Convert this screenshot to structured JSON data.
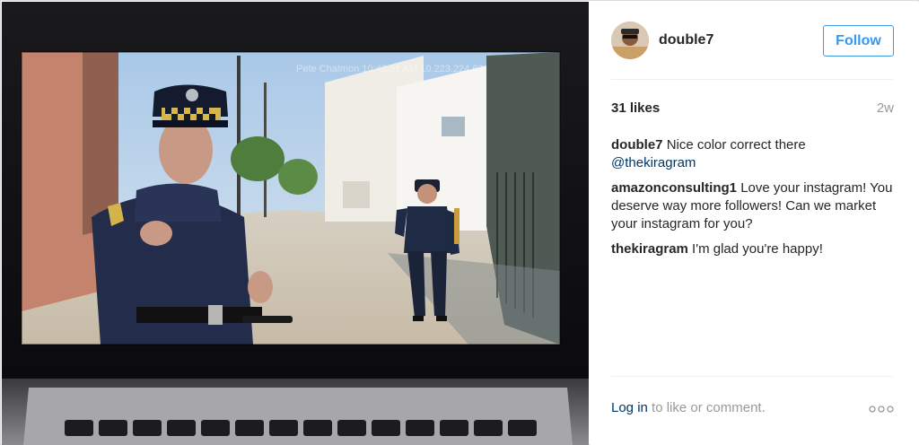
{
  "post": {
    "username": "double7",
    "follow_label": "Follow",
    "likes": "31 likes",
    "age": "2w",
    "watermark": "Pete Chatmon 10:43:51 AM 10.223.224.63",
    "comments": [
      {
        "author": "double7",
        "text": "Nice color correct there",
        "mention": "@thekiragram"
      },
      {
        "author": "amazonconsulting1",
        "text": "Love your instagram! You deserve way more followers! Can we market your instagram for you?"
      },
      {
        "author": "thekiragram",
        "text": "I'm glad you're happy!"
      }
    ],
    "login_link": "Log in",
    "login_suffix": " to like or comment."
  },
  "icons": {
    "avatar": "user-avatar",
    "more": "more-options-icon"
  },
  "colors": {
    "accent": "#3897f0",
    "link": "#003569",
    "muted": "#999999"
  }
}
